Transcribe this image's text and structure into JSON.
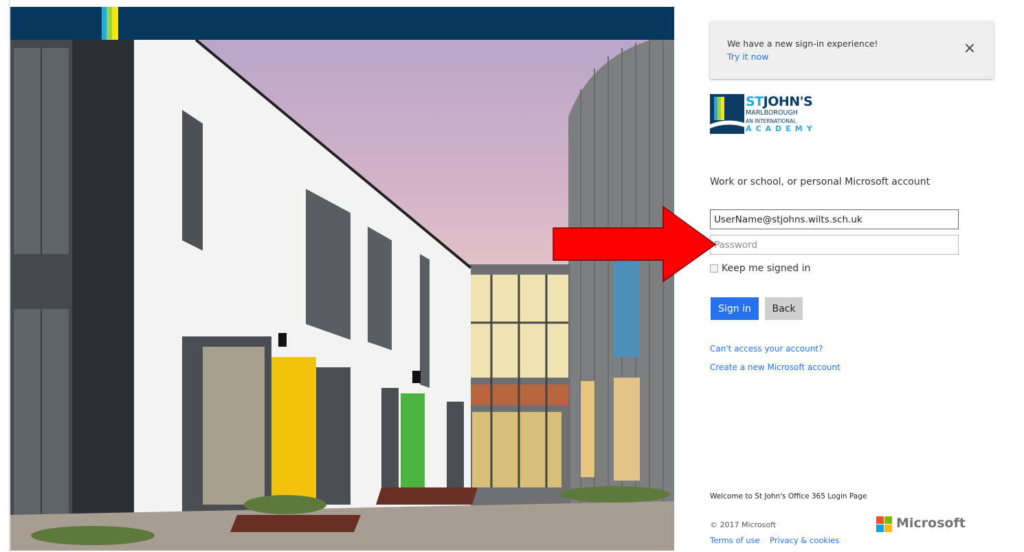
{
  "notice": {
    "text": "We have a new sign-in experience!",
    "link": "Try it now",
    "close_icon": "close-icon"
  },
  "logo": {
    "st": "ST",
    "johns": "JOHN'S",
    "line2": "MARLBOROUGH",
    "line3": "AN INTERNATIONAL",
    "line4": "ACADEMY"
  },
  "form": {
    "prompt": "Work or school, or personal Microsoft account",
    "username_value": "UserName@stjohns.wilts.sch.uk",
    "password_placeholder": "Password",
    "keep_signed_in": "Keep me signed in",
    "keep_signed_in_checked": false,
    "sign_in": "Sign in",
    "back": "Back"
  },
  "links": {
    "cant_access": "Can't access your account?",
    "create_account": "Create a new Microsoft account"
  },
  "footer": {
    "welcome": "Welcome to St John's Office 365 Login Page",
    "copyright": "© 2017 Microsoft",
    "terms": "Terms of use",
    "privacy": "Privacy & cookies",
    "brand": "Microsoft"
  },
  "colors": {
    "accent": "#2672ec",
    "header_band": "#07375c",
    "arrow": "#ff0000"
  }
}
